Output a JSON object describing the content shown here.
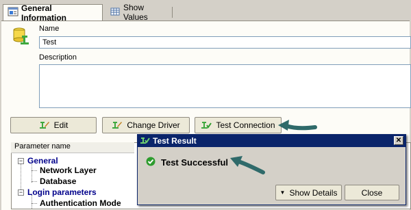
{
  "tabs": [
    {
      "label": "General Information",
      "icon": "info-tab-icon"
    },
    {
      "label": "Show Values",
      "icon": "table-grid-icon"
    }
  ],
  "form": {
    "name_label": "Name",
    "name_value": "Test",
    "description_label": "Description",
    "description_value": ""
  },
  "buttons": {
    "edit": "Edit",
    "change_driver": "Change Driver",
    "test_connection": "Test Connection"
  },
  "params": {
    "header": "Parameter name",
    "items": [
      {
        "label": "General",
        "group": true
      },
      {
        "label": "Network Layer",
        "group": false
      },
      {
        "label": "Database",
        "group": false
      },
      {
        "label": "Login parameters",
        "group": true
      },
      {
        "label": "Authentication Mode",
        "group": false
      }
    ]
  },
  "dialog": {
    "title": "Test Result",
    "message": "Test Successful",
    "show_details": "Show Details",
    "close": "Close"
  },
  "colors": {
    "title_bar": "#0a246a",
    "group_text": "#00008b",
    "success": "#2e9c2e",
    "callout_arrow": "#2f6a6a"
  }
}
